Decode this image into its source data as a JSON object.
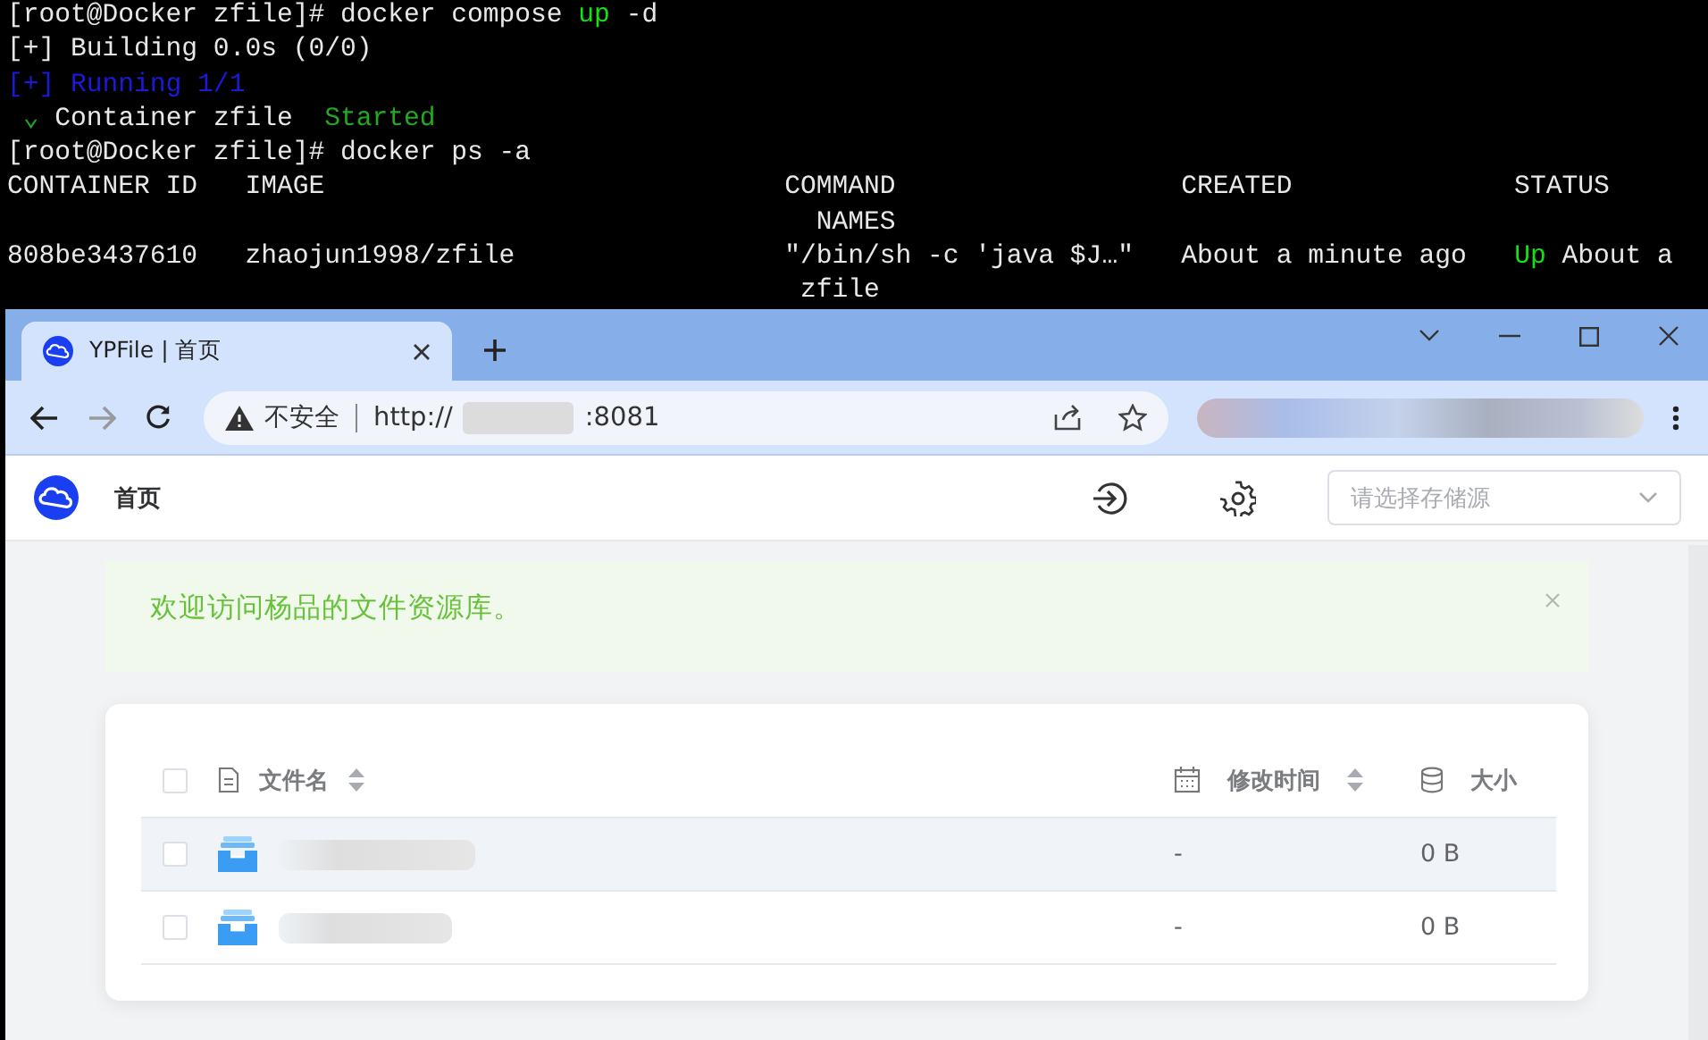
{
  "terminal": {
    "lines": [
      {
        "segments": [
          {
            "text": "[root@Docker zfile]# docker compose ",
            "kind": "plain"
          },
          {
            "text": "up",
            "kind": "bright"
          },
          {
            "text": " -d",
            "kind": "plain"
          }
        ]
      },
      {
        "segments": [
          {
            "text": "[+] Building 0.0s (0/0)",
            "kind": "plain"
          }
        ]
      },
      {
        "segments": [
          {
            "text": "[+] Running 1/1",
            "kind": "blue"
          }
        ]
      },
      {
        "segments": [
          {
            "text": " ⌄ ",
            "kind": "green"
          },
          {
            "text": "Container zfile  ",
            "kind": "plain"
          },
          {
            "text": "Started",
            "kind": "green"
          }
        ]
      },
      {
        "segments": [
          {
            "text": "[root@Docker zfile]# docker ps -a",
            "kind": "plain"
          }
        ]
      },
      {
        "segments": [
          {
            "text": "CONTAINER ID   IMAGE                             COMMAND                  CREATED              STATUS",
            "kind": "plain"
          }
        ]
      },
      {
        "segments": [
          {
            "text": "                                                   NAMES",
            "kind": "plain"
          }
        ]
      },
      {
        "segments": [
          {
            "text": "808be3437610   zhaojun1998/zfile                 \"/bin/sh -c 'java $J…\"   About a minute ago   ",
            "kind": "plain"
          },
          {
            "text": "Up",
            "kind": "bright"
          },
          {
            "text": " About a",
            "kind": "plain"
          }
        ]
      },
      {
        "segments": [
          {
            "text": "                                                  zfile",
            "kind": "plain"
          }
        ]
      }
    ]
  },
  "browser": {
    "tabs": [
      {
        "title": "YPFile | 首页",
        "selected": true
      }
    ],
    "address": {
      "security_label": "不安全",
      "url_prefix": "http://",
      "url_suffix": ":8081"
    }
  },
  "app": {
    "nav": {
      "home_label": "首页"
    },
    "storage_select": {
      "placeholder": "请选择存储源"
    },
    "alert": {
      "message": "欢迎访问杨品的文件资源库。"
    },
    "table": {
      "header_checked": false,
      "columns": [
        {
          "label": "文件名",
          "sortable": true
        },
        {
          "label": "修改时间",
          "sortable": true
        },
        {
          "label": "大小",
          "sortable": false
        }
      ],
      "rows": [
        {
          "checked": false,
          "hovered": true,
          "modified": "-",
          "size": "0 B"
        },
        {
          "checked": false,
          "hovered": false,
          "modified": "-",
          "size": "0 B"
        }
      ]
    }
  }
}
